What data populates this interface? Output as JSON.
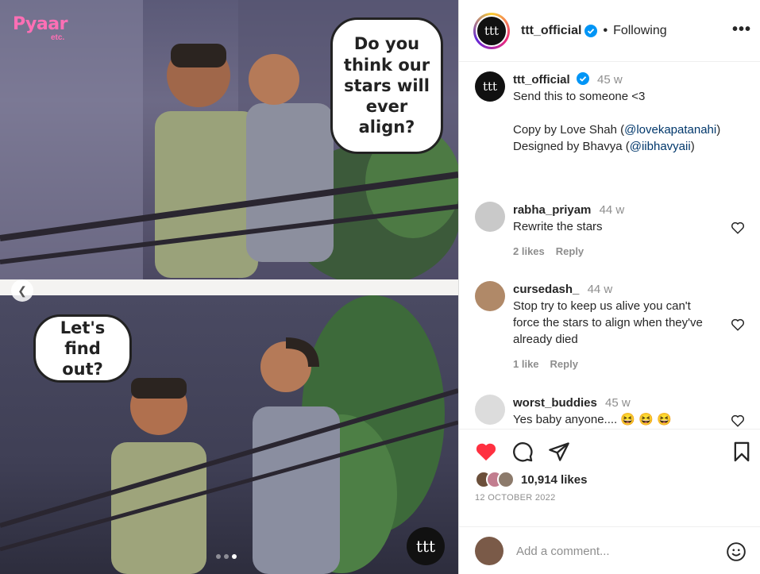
{
  "media": {
    "brand": "Pyaar",
    "brand_sub": "etc.",
    "bubble_top": "Do you think our stars will ever align?",
    "bubble_bottom": "Let's find out?",
    "watermark": "ttt",
    "carousel": {
      "total": 3,
      "active": 3
    }
  },
  "header": {
    "username": "ttt_official",
    "avatar_text": "ttt",
    "separator": "•",
    "follow_label": "Following",
    "more_label": "•••"
  },
  "caption": {
    "username": "ttt_official",
    "time": "45 w",
    "line1": "Send this to someone <3",
    "line2_prefix": "Copy by Love Shah (",
    "line2_mention": "@lovekapatanahi",
    "line2_suffix": ")",
    "line3_prefix": "Designed by Bhavya (",
    "line3_mention": "@iibhavyaii",
    "line3_suffix": ")"
  },
  "comments": [
    {
      "username": "rabha_priyam",
      "time": "44 w",
      "text": "Rewrite the stars",
      "likes": "2 likes",
      "reply": "Reply",
      "avatar_color": "#c9c9c9"
    },
    {
      "username": "cursedash_",
      "time": "44 w",
      "text": "Stop try to keep us alive you can't force the stars to align when they've already died",
      "likes": "1 like",
      "reply": "Reply",
      "avatar_color": "#b08968"
    },
    {
      "username": "worst_buddies",
      "time": "45 w",
      "text": "Yes baby anyone.... 😆 😆 😆",
      "avatar_color": "#dcdcdc"
    }
  ],
  "actions": {
    "likes": "10,914 likes",
    "date": "12 OCTOBER 2022",
    "comment_placeholder": "Add a comment..."
  },
  "colors": {
    "like_red": "#ff3040",
    "mention": "#00376b",
    "verified": "#0095f6",
    "brand_pink": "#ff6fb5"
  }
}
